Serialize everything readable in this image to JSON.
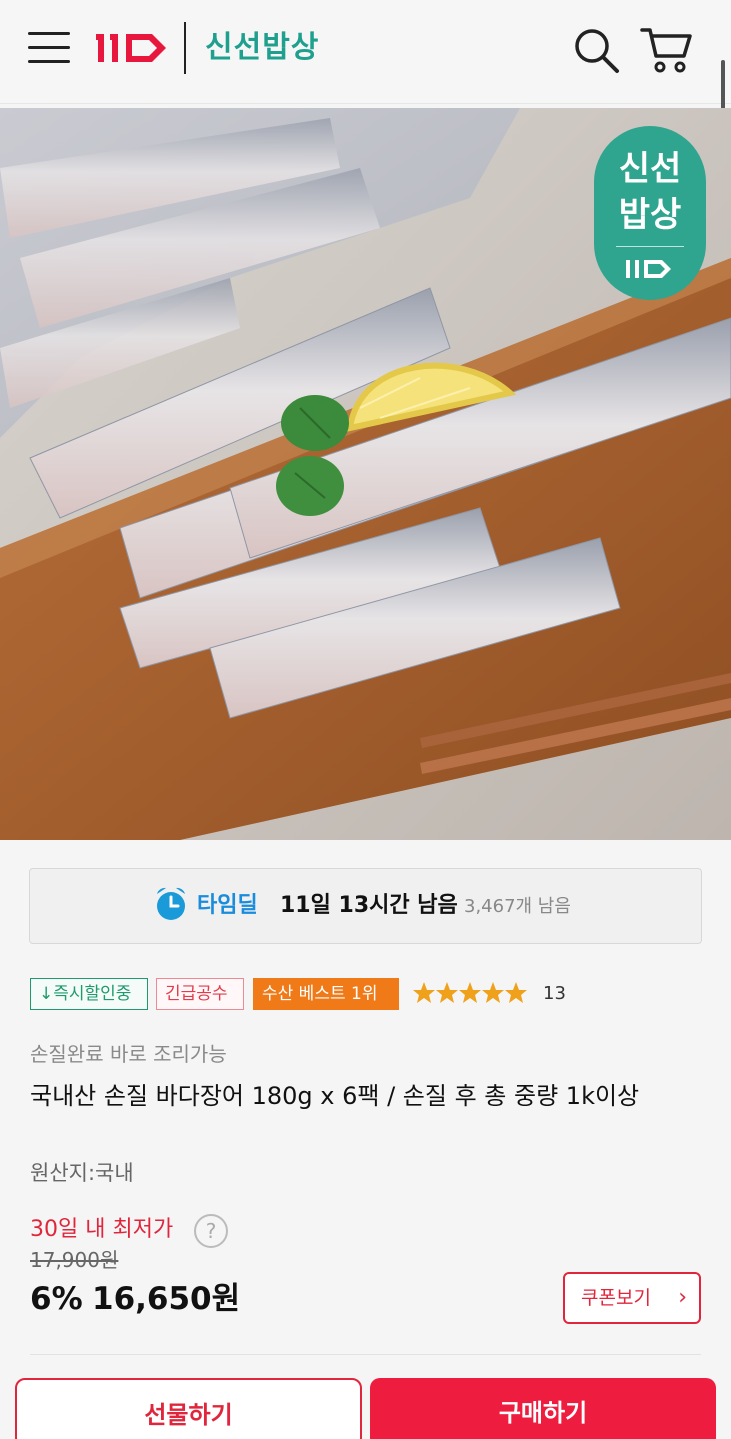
{
  "header": {
    "store_name": "신선밥상"
  },
  "badge": {
    "line1": "신선",
    "line2": "밥상"
  },
  "timedeal": {
    "label": "타임딜",
    "remaining_time": "11일 13시간 남음",
    "stock": "3,467개 남음"
  },
  "tags": {
    "instant": "↓즉시할인중",
    "urgent": "긴급공수",
    "best": "수산 베스트 1위"
  },
  "rating": {
    "stars": 5,
    "review_count": "13"
  },
  "product": {
    "subtitle": "손질완료 바로 조리가능",
    "title": "국내산 손질 바다장어 180g x 6팩 / 손질 후 총 중량 1k이상",
    "origin": "원산지:국내",
    "lowest_price_label": "30일 내 최저가",
    "help_glyph": "?",
    "original_price": "17,900원",
    "discount_rate": "6%",
    "sale_price": "16,650원"
  },
  "buttons": {
    "coupon": "쿠폰보기",
    "coupon_chevron": "›",
    "gift": "선물하기",
    "buy": "구매하기"
  },
  "colors": {
    "brand_red": "#ee1c3f",
    "brand_teal": "#1fa08f",
    "timedeal_blue": "#1a8cdc",
    "best_orange": "#f07a18"
  }
}
